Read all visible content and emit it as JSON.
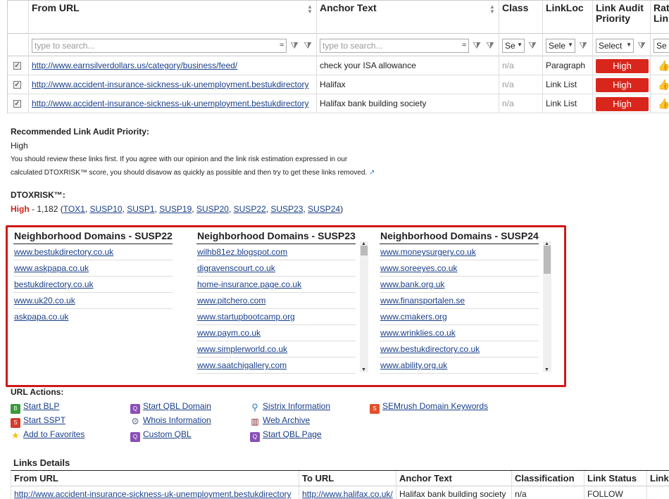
{
  "grid": {
    "columns": [
      {
        "label": "From URL"
      },
      {
        "label": "Anchor Text"
      },
      {
        "label": "Class"
      },
      {
        "label": "LinkLoc"
      },
      {
        "label": "Link Audit Priority"
      },
      {
        "label": "Rat Link"
      }
    ],
    "filters": {
      "from_placeholder": "type to search...",
      "anchor_placeholder": "type to search...",
      "approx_symbol": "≈",
      "class_select": "Se",
      "linkloc_select": "Sele",
      "priority_select": "Select",
      "rating_select": "Se"
    },
    "rows": [
      {
        "from": "http://www.earnsilverdollars.us/category/business/feed/",
        "anchor": "check your ISA allowance",
        "class": "n/a",
        "linkloc": "Paragraph",
        "priority": "High"
      },
      {
        "from": "http://www.accident-insurance-sickness-uk-unemployment.bestukdirectory",
        "anchor": "Halifax",
        "class": "n/a",
        "linkloc": "Link List",
        "priority": "High"
      },
      {
        "from": "http://www.accident-insurance-sickness-uk-unemployment.bestukdirectory",
        "anchor": "Halifax bank building society",
        "class": "n/a",
        "linkloc": "Link List",
        "priority": "High"
      }
    ]
  },
  "audit": {
    "heading": "Recommended Link Audit Priority:",
    "value": "High",
    "desc1": "You should review these links first. If you agree with our opinion and the link risk estimation expressed in our",
    "desc2": "calculated DTOXRISK™ score, you should disavow as quickly as possible and then try to get these links removed.",
    "dtox_heading": "DTOXRISK™:",
    "dtox_level": "High",
    "dtox_score": " - 1,182 (",
    "dtox_close": ")",
    "dtox_rules": [
      "TOX1",
      "SUSP10",
      "SUSP1",
      "SUSP19",
      "SUSP20",
      "SUSP22",
      "SUSP23",
      "SUSP24"
    ]
  },
  "neighborhood": [
    {
      "title": "Neighborhood Domains - SUSP22",
      "items": [
        "www.bestukdirectory.co.uk",
        "www.askpapa.co.uk",
        "bestukdirectory.co.uk",
        "www.uk20.co.uk",
        "askpapa.co.uk"
      ]
    },
    {
      "title": "Neighborhood Domains - SUSP23",
      "items": [
        "wilhb81ez.blogspot.com",
        "digravenscourt.co.uk",
        "home-insurance.page.co.uk",
        "www.pitchero.com",
        "www.startupbootcamp.org",
        "www.paym.co.uk",
        "www.simplerworld.co.uk",
        "www.saatchigallery.com"
      ]
    },
    {
      "title": "Neighborhood Domains - SUSP24",
      "items": [
        "www.moneysurgery.co.uk",
        "www.soreeyes.co.uk",
        "www.bank.org.uk",
        "www.finansportalen.se",
        "www.cmakers.org",
        "www.wrinklies.co.uk",
        "www.bestukdirectory.co.uk",
        "www.ability.org.uk"
      ]
    }
  ],
  "actions": {
    "heading": "URL Actions:",
    "items": [
      {
        "label": "Start BLP",
        "icon": "blp-icon",
        "color": "#3a9a3a"
      },
      {
        "label": "Start SSPT",
        "icon": "sspt-icon",
        "color": "#d33b2c"
      },
      {
        "label": "Add to Favorites",
        "icon": "star-icon",
        "color": "#f2c318"
      },
      {
        "label": "Start QBL Domain",
        "icon": "qbl-domain-icon",
        "color": "#8a4fb8"
      },
      {
        "label": "Whois Information",
        "icon": "whois-icon",
        "color": "#6b7a8f"
      },
      {
        "label": "Custom QBL",
        "icon": "custom-qbl-icon",
        "color": "#8a4fb8"
      },
      {
        "label": "Sistrix Information",
        "icon": "sistrix-icon",
        "color": "#2b7bc0"
      },
      {
        "label": "Web Archive",
        "icon": "web-archive-icon",
        "color": "#7a1f1f"
      },
      {
        "label": "Start QBL Page",
        "icon": "qbl-page-icon",
        "color": "#8a4fb8"
      },
      {
        "label": "SEMrush Domain Keywords",
        "icon": "semrush-icon",
        "color": "#e2502a"
      }
    ]
  },
  "links_details": {
    "title": "Links Details",
    "headers": [
      "From URL",
      "To URL",
      "Anchor Text",
      "Classification",
      "Link Status",
      "Link"
    ],
    "row": [
      "http://www.accident-insurance-sickness-uk-unemployment.bestukdirectory",
      "http://www.halifax.co.uk/",
      "Halifax bank building society",
      "n/a",
      "FOLLOW",
      ""
    ]
  }
}
